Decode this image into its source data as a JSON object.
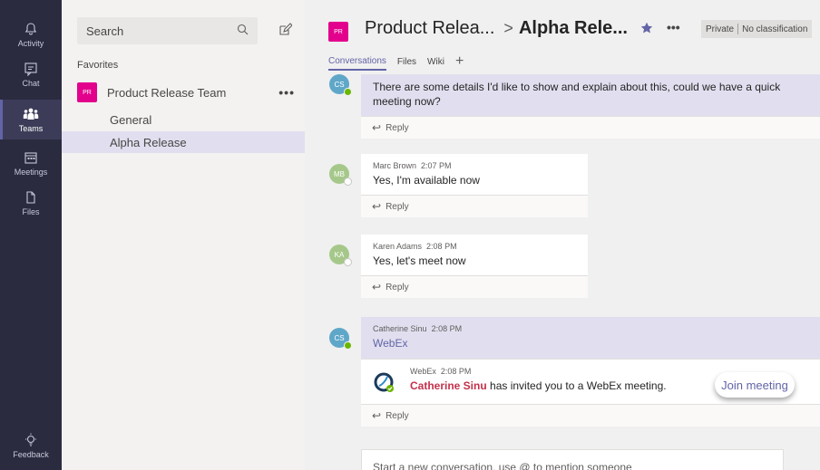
{
  "rail": {
    "items": [
      {
        "label": "Activity",
        "icon": "bell-icon"
      },
      {
        "label": "Chat",
        "icon": "chat-icon"
      },
      {
        "label": "Teams",
        "icon": "teams-icon"
      },
      {
        "label": "Meetings",
        "icon": "calendar-icon"
      },
      {
        "label": "Files",
        "icon": "file-icon"
      }
    ],
    "feedback": "Feedback"
  },
  "sidebar": {
    "search_placeholder": "Search",
    "favorites_label": "Favorites",
    "team": {
      "initials": "PR",
      "name": "Product Release Team",
      "more": "•••"
    },
    "channels": [
      "General",
      "Alpha Release"
    ],
    "selected_channel": "Alpha Release"
  },
  "header": {
    "team_initials": "PR",
    "team_name": "Product Relea...",
    "separator": ">",
    "channel_name": "Alpha Rele...",
    "more": "•••",
    "tag_private": "Private",
    "tag_classification": "No classification"
  },
  "tabs": [
    "Conversations",
    "Files",
    "Wiki"
  ],
  "messages": [
    {
      "initials": "CS",
      "author": "",
      "time": "",
      "text": "There are some details I'd like to show and explain about this, could we have a quick meeting now?",
      "reply": "Reply"
    },
    {
      "initials": "MB",
      "author": "Marc Brown",
      "time": "2:07 PM",
      "text": "Yes, I'm available now",
      "reply": "Reply"
    },
    {
      "initials": "KA",
      "author": "Karen Adams",
      "time": "2:08 PM",
      "text": "Yes, let's meet now",
      "reply": "Reply"
    },
    {
      "initials": "CS",
      "author": "Catherine Sinu",
      "time": "2:08 PM",
      "text": "WebEx",
      "reply": "Reply"
    }
  ],
  "webex_card": {
    "app": "WebEx",
    "time": "2:08 PM",
    "inviter": "Catherine Sinu",
    "invite_text": " has invited you to a WebEx meeting.",
    "join_label": "Join meeting"
  },
  "composer": {
    "placeholder": "Start a new conversation, use @ to mention someone"
  },
  "colors": {
    "rail": "#2b2b40",
    "accent": "#6264a7",
    "team": "#e3008c",
    "presence_online": "#6bb700",
    "highlight": "#e1dfef"
  }
}
